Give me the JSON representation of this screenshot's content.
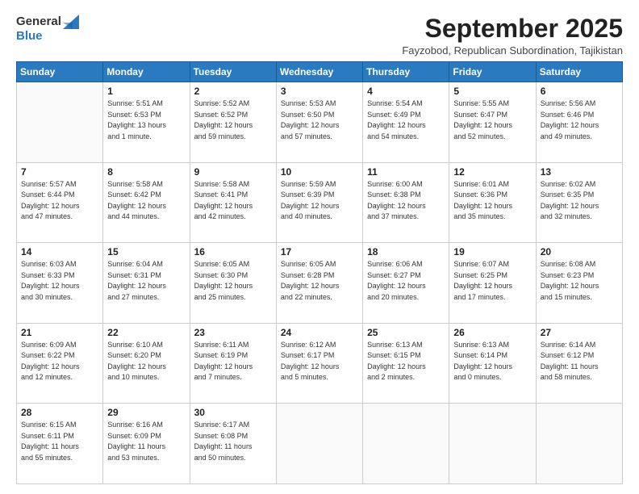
{
  "header": {
    "logo_line1": "General",
    "logo_line2": "Blue",
    "month_title": "September 2025",
    "location": "Fayzobod, Republican Subordination, Tajikistan"
  },
  "weekdays": [
    "Sunday",
    "Monday",
    "Tuesday",
    "Wednesday",
    "Thursday",
    "Friday",
    "Saturday"
  ],
  "weeks": [
    [
      {
        "day": "",
        "info": ""
      },
      {
        "day": "1",
        "info": "Sunrise: 5:51 AM\nSunset: 6:53 PM\nDaylight: 13 hours\nand 1 minute."
      },
      {
        "day": "2",
        "info": "Sunrise: 5:52 AM\nSunset: 6:52 PM\nDaylight: 12 hours\nand 59 minutes."
      },
      {
        "day": "3",
        "info": "Sunrise: 5:53 AM\nSunset: 6:50 PM\nDaylight: 12 hours\nand 57 minutes."
      },
      {
        "day": "4",
        "info": "Sunrise: 5:54 AM\nSunset: 6:49 PM\nDaylight: 12 hours\nand 54 minutes."
      },
      {
        "day": "5",
        "info": "Sunrise: 5:55 AM\nSunset: 6:47 PM\nDaylight: 12 hours\nand 52 minutes."
      },
      {
        "day": "6",
        "info": "Sunrise: 5:56 AM\nSunset: 6:46 PM\nDaylight: 12 hours\nand 49 minutes."
      }
    ],
    [
      {
        "day": "7",
        "info": "Sunrise: 5:57 AM\nSunset: 6:44 PM\nDaylight: 12 hours\nand 47 minutes."
      },
      {
        "day": "8",
        "info": "Sunrise: 5:58 AM\nSunset: 6:42 PM\nDaylight: 12 hours\nand 44 minutes."
      },
      {
        "day": "9",
        "info": "Sunrise: 5:58 AM\nSunset: 6:41 PM\nDaylight: 12 hours\nand 42 minutes."
      },
      {
        "day": "10",
        "info": "Sunrise: 5:59 AM\nSunset: 6:39 PM\nDaylight: 12 hours\nand 40 minutes."
      },
      {
        "day": "11",
        "info": "Sunrise: 6:00 AM\nSunset: 6:38 PM\nDaylight: 12 hours\nand 37 minutes."
      },
      {
        "day": "12",
        "info": "Sunrise: 6:01 AM\nSunset: 6:36 PM\nDaylight: 12 hours\nand 35 minutes."
      },
      {
        "day": "13",
        "info": "Sunrise: 6:02 AM\nSunset: 6:35 PM\nDaylight: 12 hours\nand 32 minutes."
      }
    ],
    [
      {
        "day": "14",
        "info": "Sunrise: 6:03 AM\nSunset: 6:33 PM\nDaylight: 12 hours\nand 30 minutes."
      },
      {
        "day": "15",
        "info": "Sunrise: 6:04 AM\nSunset: 6:31 PM\nDaylight: 12 hours\nand 27 minutes."
      },
      {
        "day": "16",
        "info": "Sunrise: 6:05 AM\nSunset: 6:30 PM\nDaylight: 12 hours\nand 25 minutes."
      },
      {
        "day": "17",
        "info": "Sunrise: 6:05 AM\nSunset: 6:28 PM\nDaylight: 12 hours\nand 22 minutes."
      },
      {
        "day": "18",
        "info": "Sunrise: 6:06 AM\nSunset: 6:27 PM\nDaylight: 12 hours\nand 20 minutes."
      },
      {
        "day": "19",
        "info": "Sunrise: 6:07 AM\nSunset: 6:25 PM\nDaylight: 12 hours\nand 17 minutes."
      },
      {
        "day": "20",
        "info": "Sunrise: 6:08 AM\nSunset: 6:23 PM\nDaylight: 12 hours\nand 15 minutes."
      }
    ],
    [
      {
        "day": "21",
        "info": "Sunrise: 6:09 AM\nSunset: 6:22 PM\nDaylight: 12 hours\nand 12 minutes."
      },
      {
        "day": "22",
        "info": "Sunrise: 6:10 AM\nSunset: 6:20 PM\nDaylight: 12 hours\nand 10 minutes."
      },
      {
        "day": "23",
        "info": "Sunrise: 6:11 AM\nSunset: 6:19 PM\nDaylight: 12 hours\nand 7 minutes."
      },
      {
        "day": "24",
        "info": "Sunrise: 6:12 AM\nSunset: 6:17 PM\nDaylight: 12 hours\nand 5 minutes."
      },
      {
        "day": "25",
        "info": "Sunrise: 6:13 AM\nSunset: 6:15 PM\nDaylight: 12 hours\nand 2 minutes."
      },
      {
        "day": "26",
        "info": "Sunrise: 6:13 AM\nSunset: 6:14 PM\nDaylight: 12 hours\nand 0 minutes."
      },
      {
        "day": "27",
        "info": "Sunrise: 6:14 AM\nSunset: 6:12 PM\nDaylight: 11 hours\nand 58 minutes."
      }
    ],
    [
      {
        "day": "28",
        "info": "Sunrise: 6:15 AM\nSunset: 6:11 PM\nDaylight: 11 hours\nand 55 minutes."
      },
      {
        "day": "29",
        "info": "Sunrise: 6:16 AM\nSunset: 6:09 PM\nDaylight: 11 hours\nand 53 minutes."
      },
      {
        "day": "30",
        "info": "Sunrise: 6:17 AM\nSunset: 6:08 PM\nDaylight: 11 hours\nand 50 minutes."
      },
      {
        "day": "",
        "info": ""
      },
      {
        "day": "",
        "info": ""
      },
      {
        "day": "",
        "info": ""
      },
      {
        "day": "",
        "info": ""
      }
    ]
  ]
}
